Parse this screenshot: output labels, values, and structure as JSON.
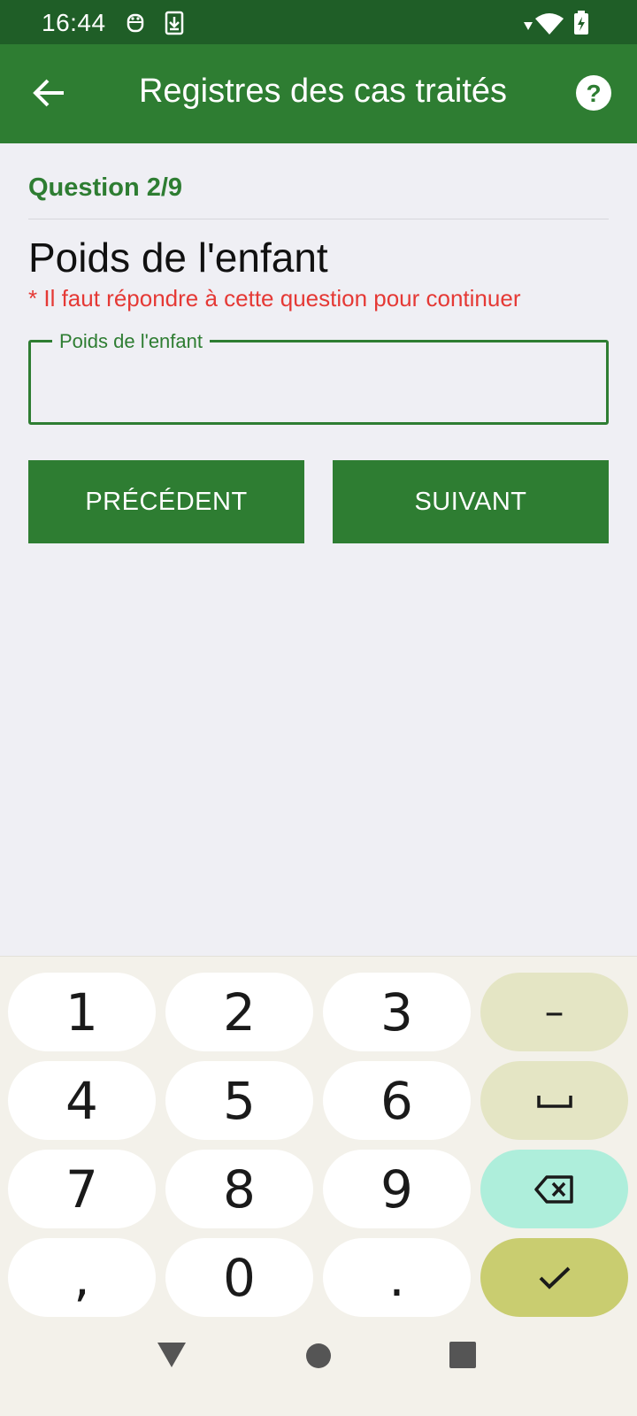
{
  "status_bar": {
    "time": "16:44"
  },
  "app_bar": {
    "title": "Registres des cas traités"
  },
  "question": {
    "counter": "Question 2/9",
    "title": "Poids de l'enfant",
    "required_message": "* Il faut répondre  à cette question pour continuer"
  },
  "field": {
    "label": "Poids de l'enfant",
    "value": ""
  },
  "buttons": {
    "previous": "PRÉCÉDENT",
    "next": "SUIVANT"
  },
  "keyboard": {
    "keys": [
      "1",
      "2",
      "3",
      "4",
      "5",
      "6",
      "7",
      "8",
      "9",
      ",",
      "0",
      "."
    ],
    "minus": "–"
  },
  "colors": {
    "primary": "#2e7d32",
    "status_bar": "#1f5e27",
    "error": "#e53935"
  }
}
